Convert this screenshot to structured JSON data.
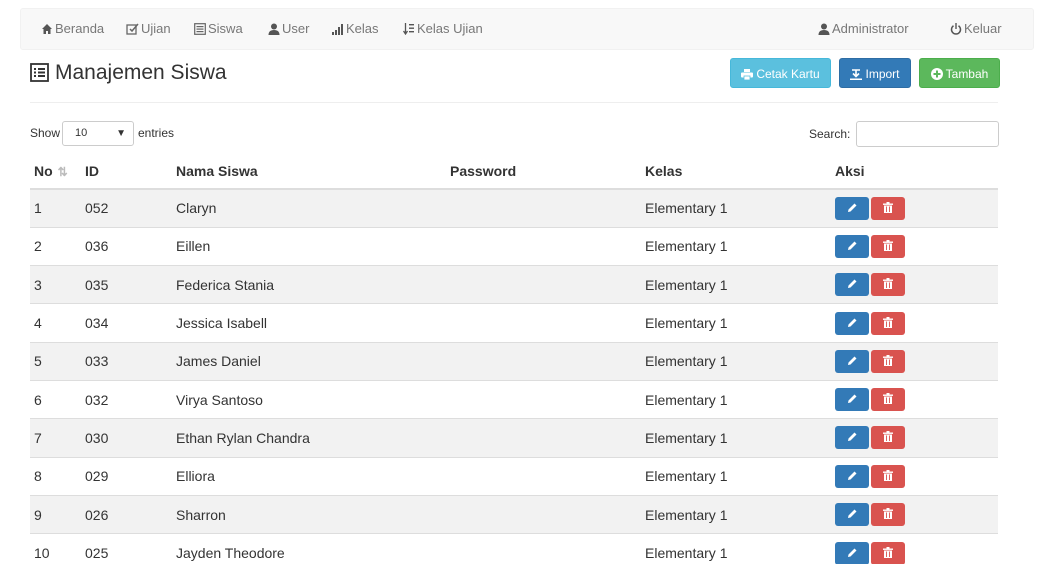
{
  "nav": {
    "beranda": "Beranda",
    "ujian": "Ujian",
    "siswa": "Siswa",
    "user": "User",
    "kelas": "Kelas",
    "kelas_ujian": "Kelas Ujian",
    "admin": "Administrator",
    "keluar": "Keluar"
  },
  "page": {
    "title": "Manajemen Siswa"
  },
  "actions": {
    "cetak": "Cetak Kartu",
    "import": "Import",
    "tambah": "Tambah"
  },
  "table_controls": {
    "show": "Show",
    "length_value": "10",
    "entries": "entries",
    "search": "Search:"
  },
  "table": {
    "headers": [
      "No",
      "ID",
      "Nama Siswa",
      "Password",
      "Kelas",
      "Aksi"
    ],
    "rows": [
      {
        "no": "1",
        "id": "052",
        "nama": "Claryn",
        "password": "",
        "kelas": "Elementary 1"
      },
      {
        "no": "2",
        "id": "036",
        "nama": "Eillen",
        "password": "",
        "kelas": "Elementary 1"
      },
      {
        "no": "3",
        "id": "035",
        "nama": "Federica Stania",
        "password": "",
        "kelas": "Elementary 1"
      },
      {
        "no": "4",
        "id": "034",
        "nama": "Jessica Isabell",
        "password": "",
        "kelas": "Elementary 1"
      },
      {
        "no": "5",
        "id": "033",
        "nama": "James Daniel",
        "password": "",
        "kelas": "Elementary 1"
      },
      {
        "no": "6",
        "id": "032",
        "nama": "Virya Santoso",
        "password": "",
        "kelas": "Elementary 1"
      },
      {
        "no": "7",
        "id": "030",
        "nama": "Ethan Rylan Chandra",
        "password": "",
        "kelas": "Elementary 1"
      },
      {
        "no": "8",
        "id": "029",
        "nama": "Elliora",
        "password": "",
        "kelas": "Elementary 1"
      },
      {
        "no": "9",
        "id": "026",
        "nama": "Sharron",
        "password": "",
        "kelas": "Elementary 1"
      },
      {
        "no": "10",
        "id": "025",
        "nama": "Jayden Theodore",
        "password": "",
        "kelas": "Elementary 1"
      }
    ]
  },
  "colors": {
    "info": "#5bc0de",
    "primary": "#337ab7",
    "success": "#5cb85c",
    "danger": "#d9534f"
  }
}
